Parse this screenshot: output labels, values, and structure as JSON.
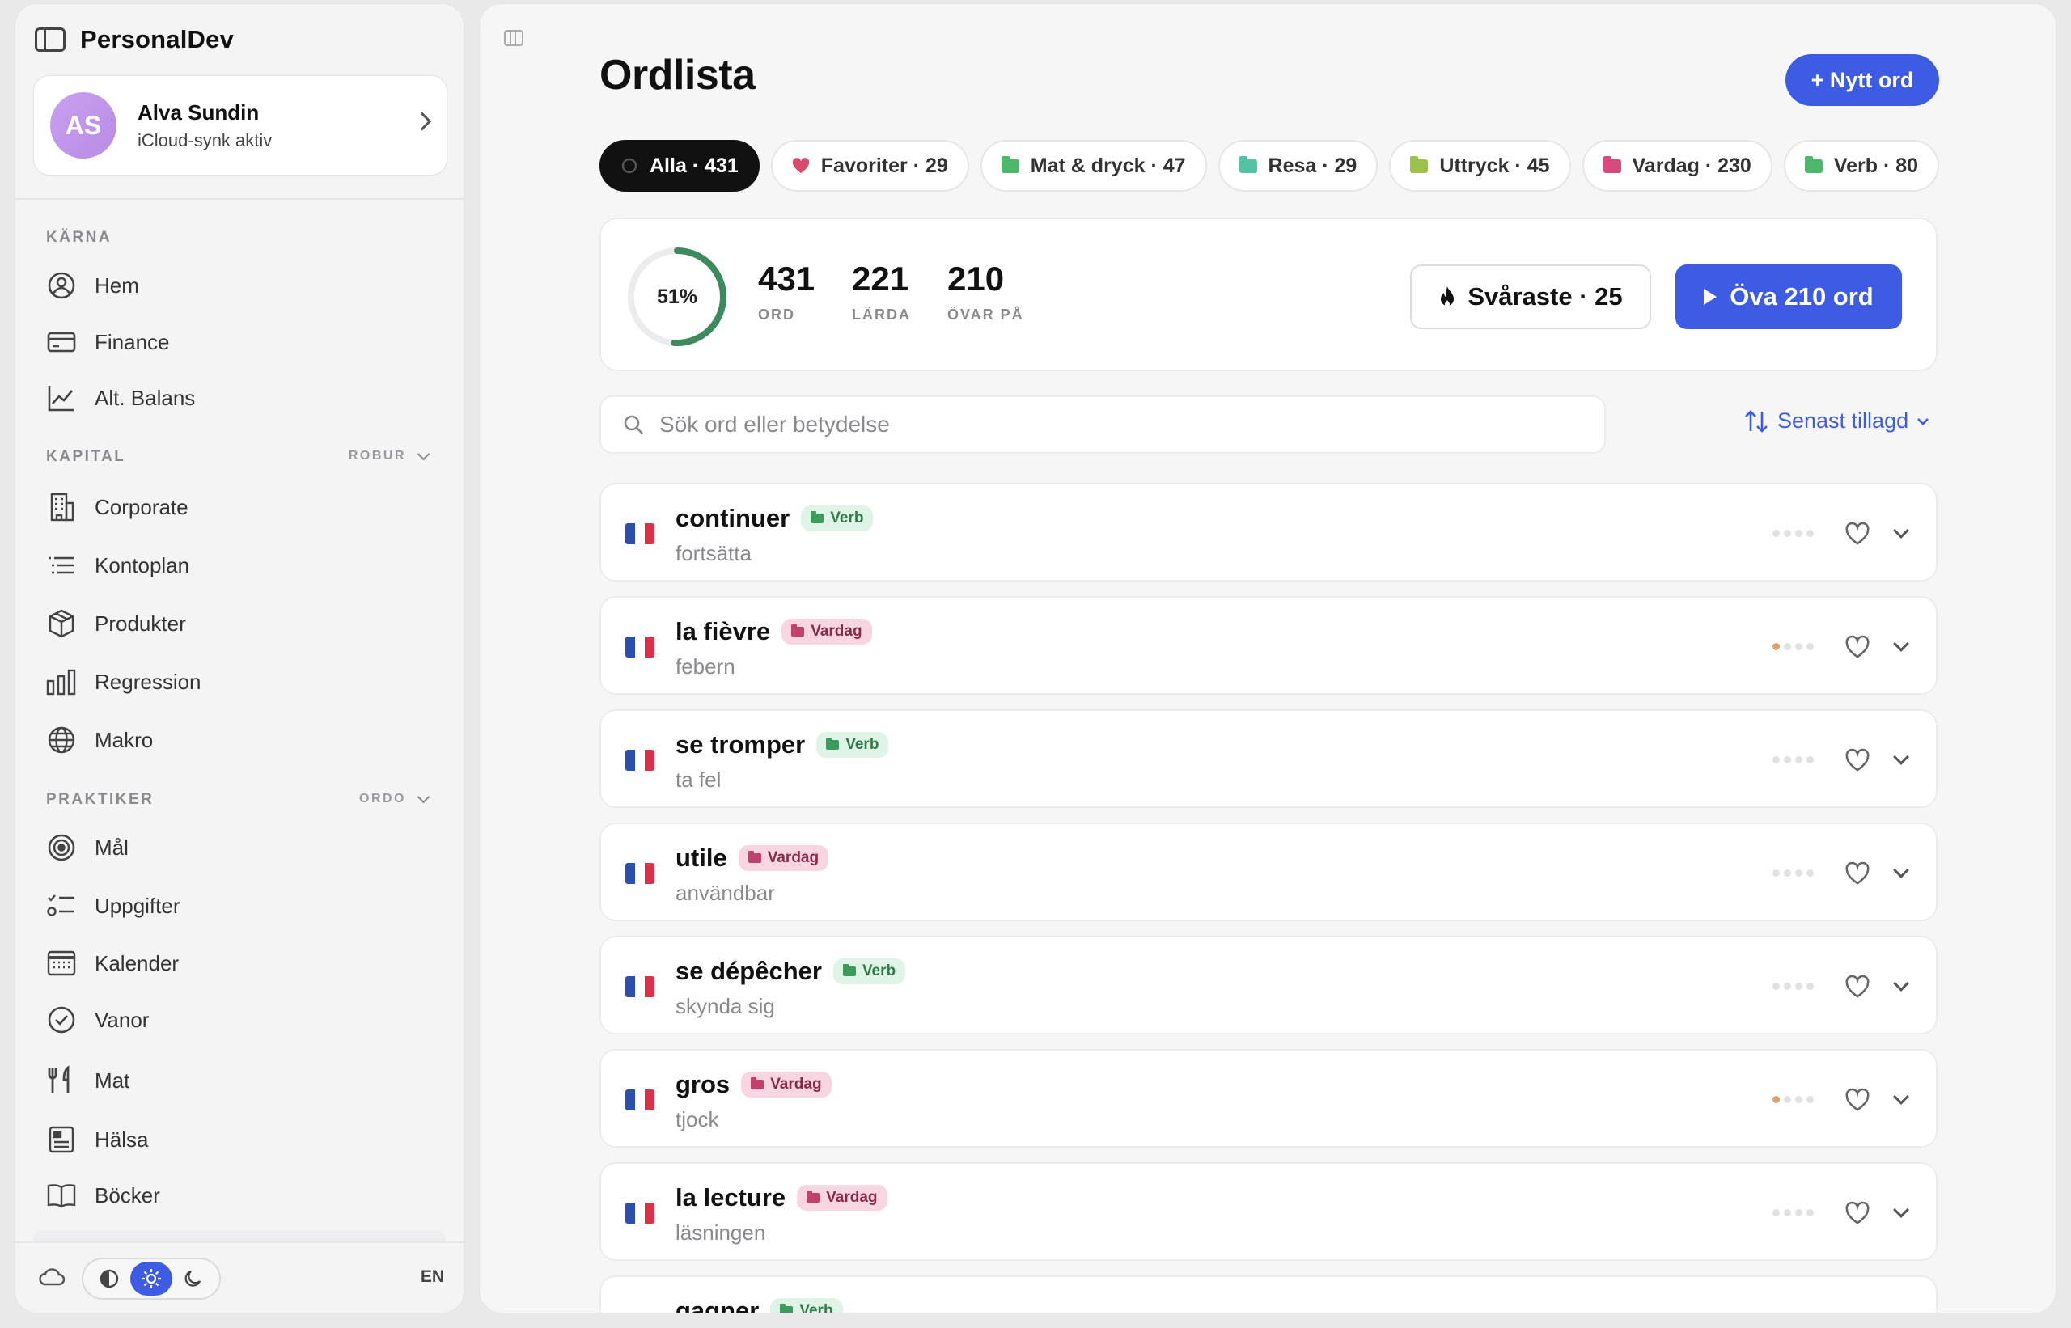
{
  "brand": {
    "name": "PersonalDev"
  },
  "profile": {
    "initials": "AS",
    "name": "Alva Sundin",
    "status": "iCloud-synk aktiv"
  },
  "sidebar": {
    "sections": [
      {
        "label": "KÄRNA",
        "extra": ""
      },
      {
        "label": "KAPITAL",
        "extra": "ROBUR"
      },
      {
        "label": "PRAKTIKER",
        "extra": "ORDO"
      }
    ],
    "items": [
      {
        "label": "Hem",
        "icon": "user-circle-icon"
      },
      {
        "label": "Finance",
        "icon": "credit-card-icon"
      },
      {
        "label": "Alt. Balans",
        "icon": "line-chart-icon"
      },
      {
        "label": "Corporate",
        "icon": "building-icon"
      },
      {
        "label": "Kontoplan",
        "icon": "list-icon"
      },
      {
        "label": "Produkter",
        "icon": "box-icon"
      },
      {
        "label": "Regression",
        "icon": "bar-chart-icon"
      },
      {
        "label": "Makro",
        "icon": "globe-icon"
      },
      {
        "label": "Mål",
        "icon": "target-icon"
      },
      {
        "label": "Uppgifter",
        "icon": "checklist-icon"
      },
      {
        "label": "Kalender",
        "icon": "calendar-icon"
      },
      {
        "label": "Vanor",
        "icon": "check-circle-icon"
      },
      {
        "label": "Mat",
        "icon": "fork-knife-icon"
      },
      {
        "label": "Hälsa",
        "icon": "health-card-icon"
      },
      {
        "label": "Böcker",
        "icon": "book-icon"
      }
    ],
    "footer": {
      "language": "EN"
    }
  },
  "main": {
    "title": "Ordlista",
    "new_button": "+ Nytt ord",
    "filters": [
      {
        "label": "Alla · 431",
        "active": true,
        "color": "#111111"
      },
      {
        "label": "Favoriter · 29",
        "active": false,
        "color": "#d94a6a"
      },
      {
        "label": "Mat & dryck · 47",
        "active": false,
        "color": "#4cb86a"
      },
      {
        "label": "Resa · 29",
        "active": false,
        "color": "#54c2a4"
      },
      {
        "label": "Uttryck · 45",
        "active": false,
        "color": "#9cc24a"
      },
      {
        "label": "Vardag · 230",
        "active": false,
        "color": "#d84a7c"
      },
      {
        "label": "Verb · 80",
        "active": false,
        "color": "#4cb86a"
      },
      {
        "label": "·",
        "active": false,
        "color": "#999999"
      }
    ],
    "stats": {
      "progress_percent": 51,
      "progress_label": "51%",
      "words": {
        "value": "431",
        "label": "ORD"
      },
      "learned": {
        "value": "221",
        "label": "LÄRDA"
      },
      "practicing": {
        "value": "210",
        "label": "ÖVAR PÅ"
      },
      "hardest_button": "Svåraste · 25",
      "practice_button": "Öva 210 ord"
    },
    "search": {
      "placeholder": "Sök ord eller betydelse",
      "value": ""
    },
    "sort": {
      "label": "Senast tillagd"
    },
    "words": [
      {
        "word": "continuer",
        "tag": "Verb",
        "meaning": "fortsätta",
        "level": 0
      },
      {
        "word": "la fièvre",
        "tag": "Vardag",
        "meaning": "febern",
        "level": 1
      },
      {
        "word": "se tromper",
        "tag": "Verb",
        "meaning": "ta fel",
        "level": 0
      },
      {
        "word": "utile",
        "tag": "Vardag",
        "meaning": "användbar",
        "level": 0
      },
      {
        "word": "se dépêcher",
        "tag": "Verb",
        "meaning": "skynda sig",
        "level": 0
      },
      {
        "word": "gros",
        "tag": "Vardag",
        "meaning": "tjock",
        "level": 1
      },
      {
        "word": "la lecture",
        "tag": "Vardag",
        "meaning": "läsningen",
        "level": 0
      },
      {
        "word": "gagner",
        "tag": "Verb",
        "meaning": "",
        "level": 0
      }
    ]
  },
  "colors": {
    "accent": "#3d5ce3",
    "ring": "#3e8a5f",
    "fab_icon": "#d6334a"
  }
}
